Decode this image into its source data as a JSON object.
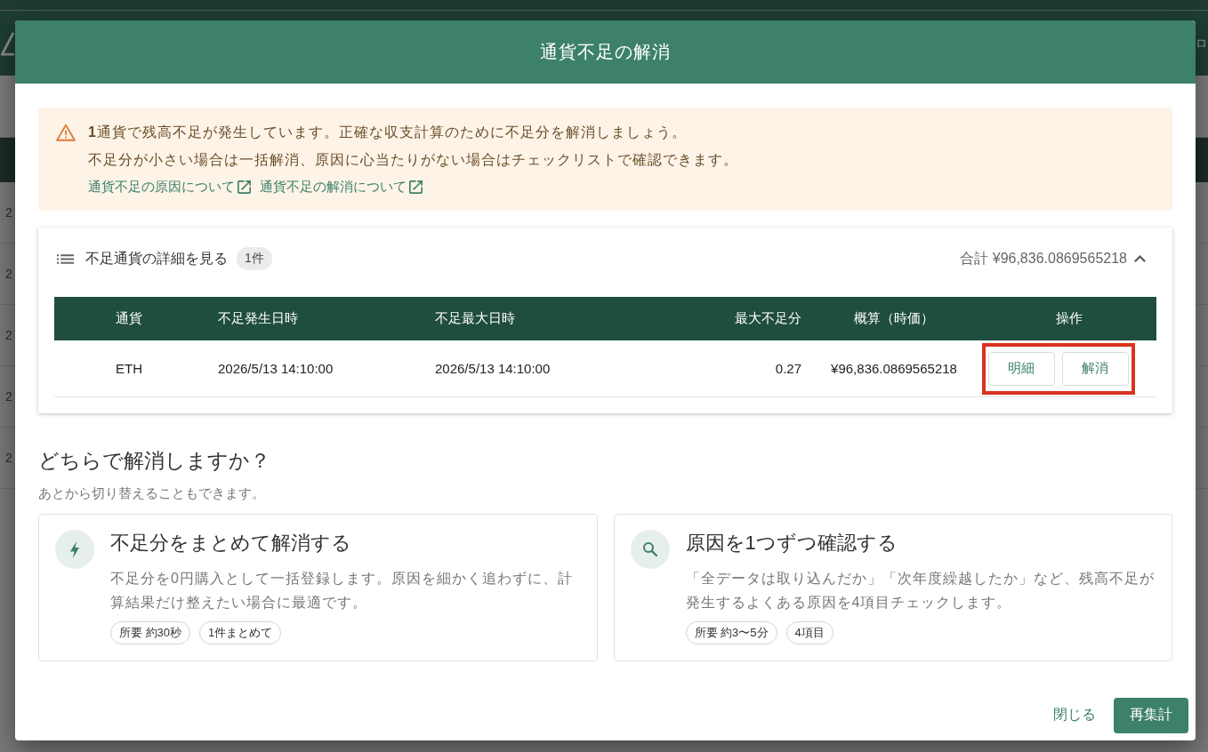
{
  "background": {
    "nav_fragment": "ロ",
    "row_fragments": [
      "2",
      "2",
      "2",
      "2",
      "2"
    ]
  },
  "dialog": {
    "title": "通貨不足の解消",
    "alert": {
      "lines": [
        "**1**通貨で残高不足が発生しています。正確な収支計算のために不足分を解消しましょう。",
        "不足分が小さい場合は一括解消、原因に心当たりがない場合はチェックリストで確認できます。"
      ],
      "links": [
        {
          "label": "通貨不足の原因について"
        },
        {
          "label": "通貨不足の解消について"
        }
      ]
    },
    "details": {
      "label": "不足通貨の詳細を見る",
      "count_badge": "1件",
      "total": "合計 ¥96,836.0869565218",
      "expanded": true,
      "table": {
        "columns": [
          "通貨",
          "不足発生日時",
          "不足最大日時",
          "最大不足分",
          "概算（時価）",
          "操作"
        ],
        "rows": [
          {
            "cells": [
              "ETH",
              "2026/5/13 14:10:00",
              "2026/5/13 14:10:00",
              "0.27",
              "¥96,836.0869565218"
            ],
            "actions": [
              {
                "label": "明細"
              },
              {
                "label": "解消"
              }
            ],
            "highlighted": true
          }
        ]
      }
    },
    "question": "どちらで解消しますか？",
    "question_hint": "あとから切り替えることもできます。",
    "options": [
      {
        "kind": "bolt",
        "title": "不足分をまとめて解消する",
        "description": "不足分を0円購入として一括登録します。原因を細かく追わずに、計算結果だけ整えたい場合に最適です。",
        "tags": [
          "所要 約30秒",
          "1件まとめて"
        ]
      },
      {
        "kind": "search",
        "title": "原因を1つずつ確認する",
        "description": "「全データは取り込んだか」「次年度繰越したか」など、残高不足が発生するよくある原因を4項目チェックします。",
        "tags": [
          "所要 約3〜5分",
          "4項目"
        ]
      }
    ],
    "footer": {
      "buttons": [
        {
          "kind": "text",
          "label": "閉じる"
        },
        {
          "kind": "primary",
          "label": "再集計"
        }
      ]
    }
  }
}
